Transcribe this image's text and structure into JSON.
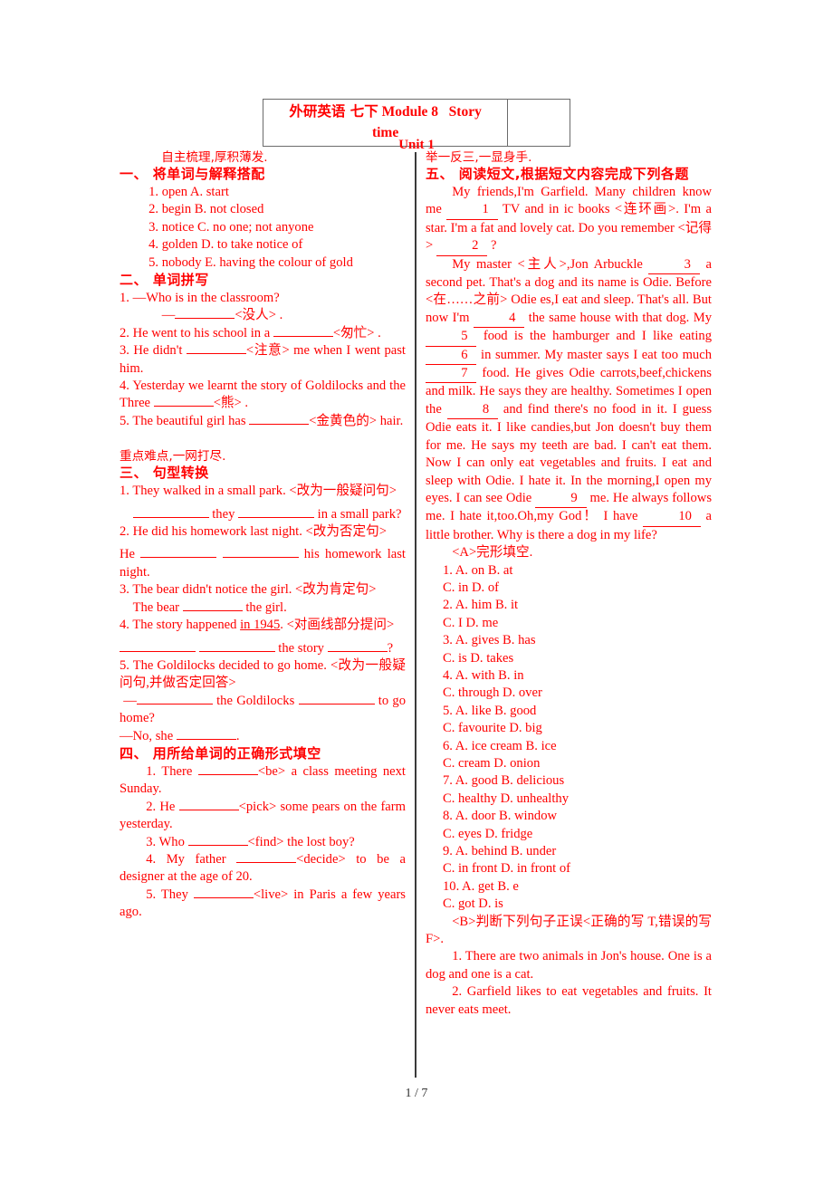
{
  "header": {
    "title_line1_cn": "外研英语 七下",
    "title_line1_en": "Module 8",
    "title_line1_en2": "Story",
    "title_line2": "time",
    "blank_cell": "",
    "unit": "Unit 1"
  },
  "left": {
    "banner1": "自主梳理,厚积薄发.",
    "section1": {
      "head": "一、  将单词与解释搭配",
      "items": [
        "1. open    A. start",
        "2. begin    B. not closed",
        "3. notice    C. no one;  not anyone",
        "4. golden    D. to take notice of",
        "5. nobody    E. having the colour of gold"
      ]
    },
    "section2": {
      "head": "二、  单词拼写",
      "q1_a": "1. —Who is in the classroom?",
      "q1_b_pre": "—",
      "q1_b_post": "<没人> .",
      "q2_pre": "2. He went to his school in a ",
      "q2_post": "<匆忙> .",
      "q3_pre": "3. He didn't ",
      "q3_post": "<注意> me when I went past him.",
      "q4_pre": "4. Yesterday we learnt the story of Goldilocks and the Three ",
      "q4_post": "<熊> .",
      "q5_pre": "5. The beautiful girl has ",
      "q5_post": "<金黄色的> hair."
    },
    "banner2": "重点难点,一网打尽.",
    "section3": {
      "head": "三、  句型转换",
      "q1": "1. They walked in a small park. <改为一般疑问句>",
      "q1_ans_mid": " they ",
      "q1_ans_end": " in a small park?",
      "q2": "2. He did his homework last night. <改为否定句>",
      "q2_ans_pre": "He ",
      "q2_ans_end": " his homework last night.",
      "q3": "3. The bear didn't notice the girl. <改为肯定句>",
      "q3_ans_pre": "The bear ",
      "q3_ans_end": " the girl.",
      "q4": "4. The story happened ",
      "q4_underlined": "in 1945",
      "q4_post": ". <对画线部分提问>",
      "q4_ans_mid": " the story ",
      "q4_ans_end": "?",
      "q5": "5. The Goldilocks decided to go home. <改为一般疑问句,并做否定回答>",
      "q5_ans_pre": "—",
      "q5_ans_mid": " the Goldilocks ",
      "q5_ans_end": " to go home?",
      "q5_ans2_pre": "—No, she ",
      "q5_ans2_end": "."
    },
    "section4": {
      "head": "四、  用所给单词的正确形式填空",
      "q1_pre": "1. There ",
      "q1_post": "<be> a class meeting next Sunday.",
      "q2_pre": "2. He ",
      "q2_post": "<pick> some pears on the farm yesterday.",
      "q3_pre": "3. Who ",
      "q3_post": "<find> the lost boy?",
      "q4_pre": "4. My father ",
      "q4_post": "<decide> to be a designer at the age of 20.",
      "q5_pre": "5. They ",
      "q5_post": "<live> in Paris a few years ago."
    }
  },
  "right": {
    "banner1": "举一反三,一显身手.",
    "section5": {
      "head": "五、  阅读短文,根据短文内容完成下列各题",
      "passage_p1_a": "My friends,I'm Garfield. Many children know me ",
      "passage_p1_n1": "1",
      "passage_p1_b": " TV and in ic books <连环画>. I'm a star. I'm a fat and lovely cat. Do you remember <记得> ",
      "passage_p1_n2": "2",
      "passage_p1_c": " ?",
      "passage_p2_a": "My master <主人>,Jon Arbuckle ",
      "passage_p2_n3": "3",
      "passage_p2_b": " a second pet. That's a dog and its name is Odie. Before <在……之前> Odie es,I eat and sleep. That's all. But now I'm ",
      "passage_p2_n4": "4",
      "passage_p2_c": " the same house with that dog. My ",
      "passage_p2_n5": "5",
      "passage_p2_d": " food is the hamburger and I like eating ",
      "passage_p2_n6": "6",
      "passage_p2_e": " in summer. My master says I eat too much ",
      "passage_p2_n7": "7",
      "passage_p2_f": " food. He gives Odie carrots,beef,chickens and milk. He says they are healthy. Sometimes I open the ",
      "passage_p2_n8": "8",
      "passage_p2_g": " and find there's no food in it. I guess Odie eats it. I like candies,but Jon doesn't buy them for me. He says my teeth are bad. I can't eat them. Now I can only eat vegetables and fruits. I eat and sleep with Odie. I hate it. In the morning,I open my eyes. I can see Odie ",
      "passage_p2_n9": "9",
      "passage_p2_h": " me. He always follows me. I hate it,too.Oh,my God！ I have ",
      "passage_p2_n10": "10",
      "passage_p2_i": " a little brother. Why is there a dog in my life?",
      "partA_head": "<A>完形填空.",
      "options": [
        {
          "line1": "1. A. on    B. at",
          "line2": "C. in    D. of"
        },
        {
          "line1": "2. A. him    B. it",
          "line2": "C. I    D. me"
        },
        {
          "line1": "3. A. gives    B. has",
          "line2": "C. is    D. takes"
        },
        {
          "line1": "4. A. with    B. in",
          "line2": "C. through    D. over"
        },
        {
          "line1": "5. A. like    B. good",
          "line2": "C. favourite    D. big"
        },
        {
          "line1": "6. A. ice cream    B. ice",
          "line2": "C. cream    D. onion"
        },
        {
          "line1": "7. A. good    B. delicious",
          "line2": "C. healthy    D. unhealthy"
        },
        {
          "line1": "8. A. door    B. window",
          "line2": "C. eyes    D. fridge"
        },
        {
          "line1": "9. A. behind    B. under",
          "line2": "C. in front    D. in front of"
        },
        {
          "line1": "10. A. get    B. e",
          "line2": "C. got    D. is"
        }
      ],
      "partB_head": "<B>判断下列句子正误<正确的写 T,错误的写 F>.",
      "tf_items": [
        "1. There are two animals in Jon's house. One is a dog and one is a cat.",
        "2. Garfield likes to eat vegetables and fruits. It never eats meet."
      ]
    }
  },
  "footer": {
    "page": "1 / 7"
  }
}
